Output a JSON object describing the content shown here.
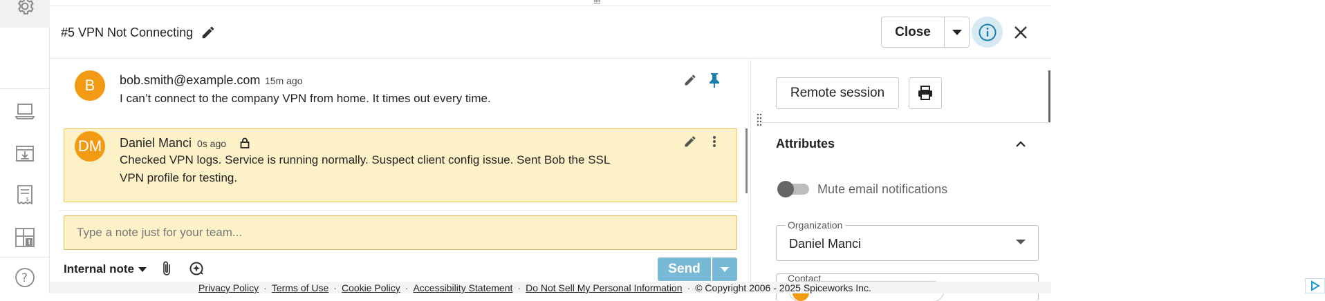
{
  "sidebar": {
    "items": [
      {
        "icon": "gear-icon"
      },
      {
        "icon": "laptop-icon"
      },
      {
        "icon": "download-icon"
      },
      {
        "icon": "invoice-icon"
      },
      {
        "icon": "dashboard-alert-icon"
      },
      {
        "icon": "help-icon"
      }
    ]
  },
  "header": {
    "title": "#5 VPN Not Connecting",
    "close_label": "Close"
  },
  "messages": [
    {
      "avatar": "B",
      "author": "bob.smith@example.com",
      "time": "15m ago",
      "body": "I can’t connect to the company VPN from home. It times out every time."
    },
    {
      "avatar": "DM",
      "author": "Daniel Manci",
      "time": "0s ago",
      "body": "Checked VPN logs. Service is running normally. Suspect client config issue. Sent Bob the SSL VPN profile for testing."
    }
  ],
  "composer": {
    "placeholder": "Type a note just for your team...",
    "mode_label": "Internal note",
    "send_label": "Send"
  },
  "right_panel": {
    "remote_session_label": "Remote session",
    "attributes_title": "Attributes",
    "mute_label": "Mute email notifications",
    "organization_label": "Organization",
    "organization_value": "Daniel Manci",
    "contact_label": "Contact"
  },
  "footer": {
    "privacy": "Privacy Policy",
    "terms": "Terms of Use",
    "cookie": "Cookie Policy",
    "accessibility": "Accessibility Statement",
    "dnsmpi": "Do Not Sell My Personal Information",
    "copyright": "© Copyright 2006 - 2025 Spiceworks Inc."
  },
  "colors": {
    "avatar": "#f29a14",
    "note_bg": "#fdf1c8",
    "send": "#78b9d5",
    "pin": "#1b7fb0"
  }
}
